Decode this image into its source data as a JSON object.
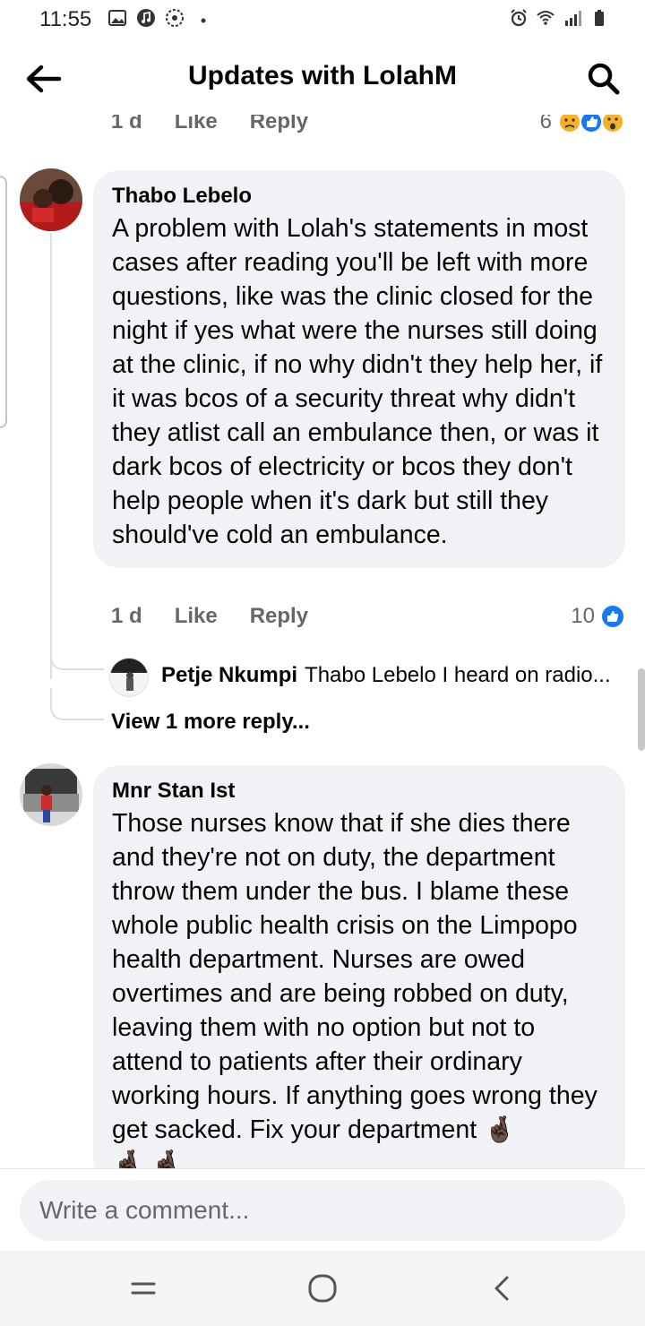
{
  "status_bar": {
    "time": "11:55",
    "left_icons": [
      "gallery-icon",
      "music-icon",
      "settings-circle-icon",
      "dot-icon"
    ],
    "right_icons": [
      "alarm-icon",
      "wifi-icon",
      "signal-icon",
      "battery-icon"
    ]
  },
  "header": {
    "title": "Updates with LolahM",
    "back_icon": "arrow-left-icon",
    "search_icon": "search-icon"
  },
  "top_meta": {
    "time": "1 d",
    "like": "Like",
    "reply": "Reply",
    "reaction_count": "6",
    "reactions": [
      "sad-icon",
      "like-icon",
      "wow-icon"
    ]
  },
  "comments": [
    {
      "author": "Thabo Lebelo",
      "text": "A problem with Lolah's statements in most cases after reading you'll be left with more questions, like was the clinic closed for the night if yes what were the nurses still doing at the clinic, if no why didn't they help her, if it was bcos of a security threat why didn't they atlist call an embulance then, or was it dark bcos of electricity or bcos they don't help people when it's dark but still they should've cold an embulance.",
      "time": "1 d",
      "like": "Like",
      "reply": "Reply",
      "reaction_count": "10",
      "reply_preview": {
        "author": "Petje Nkumpi",
        "text": "Thabo Lebelo I heard on radio..."
      },
      "more_replies": "View 1 more reply..."
    },
    {
      "author": "Mnr Stan Ist",
      "text": "Those nurses know that if she dies there and they're not on duty, the department throw them under the bus. I blame these whole public health crisis on the Limpopo health department. Nurses are owed overtimes and are being robbed on duty, leaving them with no option but not to attend to patients after their ordinary working hours. If anything goes wrong they get sacked. Fix your department",
      "emoji": "🤞🏿"
    }
  ],
  "composer": {
    "placeholder": "Write a comment..."
  },
  "navbar": {
    "icons": [
      "recent-apps-icon",
      "home-icon",
      "back-icon"
    ]
  },
  "colors": {
    "bubble": "#f0f2f5",
    "meta_text": "#65676b",
    "like_blue": "#1877f2"
  }
}
